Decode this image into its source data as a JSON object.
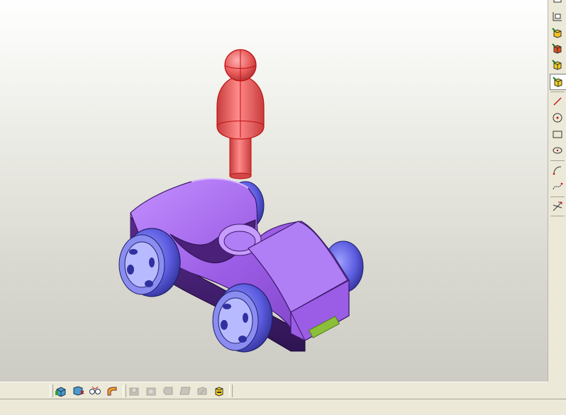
{
  "viewport": {
    "background_top": "#ffffff",
    "background_bottom": "#cdccc4",
    "model": {
      "car_body_color": "#9b5de5",
      "wheel_color": "#5c5ce0",
      "peg_figure_color": "#e85a5a",
      "plate_color": "#8bbf3a"
    }
  },
  "right_toolbar": {
    "items": [
      {
        "icon": "partial-icon"
      },
      {
        "icon": "sketch-plane-icon"
      },
      {
        "icon": "view-cube-top-icon"
      },
      {
        "icon": "view-cube-front-icon"
      },
      {
        "icon": "view-cube-right-icon"
      },
      {
        "icon": "view-cube-iso-icon"
      },
      {
        "icon": "line-icon"
      },
      {
        "icon": "circle-icon"
      },
      {
        "icon": "rectangle-icon"
      },
      {
        "icon": "ellipse-icon"
      },
      {
        "icon": "arc-icon"
      },
      {
        "icon": "spline-icon"
      },
      {
        "icon": "trim-icon"
      }
    ]
  },
  "bottom_toolbar": {
    "items": [
      {
        "icon": "extrude-icon",
        "enabled": true
      },
      {
        "icon": "revolve-icon",
        "enabled": true
      },
      {
        "icon": "loft-icon",
        "enabled": true
      },
      {
        "icon": "sweep-icon",
        "enabled": true
      },
      {
        "icon": "shell-icon",
        "enabled": false
      },
      {
        "icon": "fillet-icon",
        "enabled": false
      },
      {
        "icon": "chamfer-icon",
        "enabled": false
      },
      {
        "icon": "draft-icon",
        "enabled": false
      },
      {
        "icon": "rib-icon",
        "enabled": false
      },
      {
        "icon": "hole-icon",
        "enabled": true
      }
    ]
  },
  "status_bar": {
    "text": ""
  }
}
